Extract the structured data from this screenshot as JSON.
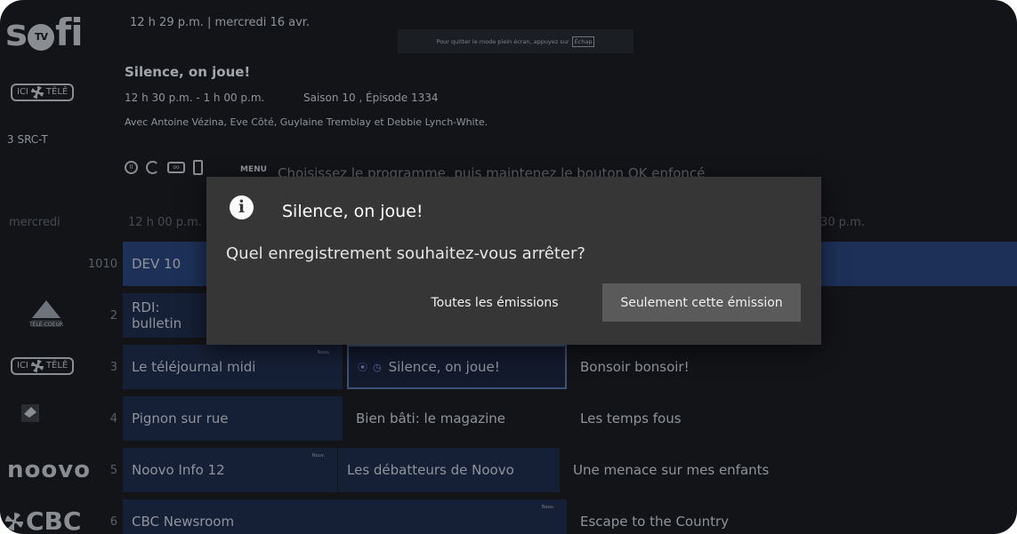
{
  "brand": {
    "logo_left": "s",
    "logo_tv": "TV",
    "logo_right": "fi"
  },
  "header": {
    "time": "12 h 29 p.m.  |  mercredi 16 avr.",
    "fullscreen_notice": "Pour quitter le mode plein écran, appuyez sur",
    "fullscreen_key": "Échap"
  },
  "program": {
    "title": "Silence, on joue!",
    "time_range": "12 h 30 p.m. - 1 h 00 p.m.",
    "season_episode": "Saison 10 , Épisode 1334",
    "cast": "Avec Antoine Vézina, Eve Côté, Guylaine Tremblay et Debbie Lynch-White.",
    "channel_label": "3  SRC-T",
    "channel_logo_left": "ICI",
    "channel_logo_right": "TÊLÊ"
  },
  "controls": {
    "menu_label": "MENU",
    "hint": "Choisissez le programme, puis maintenez le bouton OK enfoncé"
  },
  "timeline": {
    "day": "mercredi",
    "t_start": "12 h 00 p.m.",
    "t_end": "30 p.m."
  },
  "guide": {
    "rows": [
      {
        "number": "1010",
        "logo": "",
        "cells": [
          "DEV 10"
        ]
      },
      {
        "number": "2",
        "logo": "TÉLÉ-COEUR",
        "cells": [
          "RDI: bulletin"
        ]
      },
      {
        "number": "3",
        "logo_left": "ICI",
        "logo_right": "TÊLÊ",
        "cells": [
          "Le téléjournal midi",
          "Silence, on joue!",
          "Bonsoir bonsoir!"
        ],
        "badge": "Nouv."
      },
      {
        "number": "4",
        "logo": "Télé-Québec",
        "cells": [
          "Pignon sur rue",
          "Bien bâti: le magazine",
          "Les temps fous"
        ]
      },
      {
        "number": "5",
        "logo": "noovo",
        "cells": [
          "Noovo Info 12",
          "Les débatteurs de Noovo",
          "Une menace sur mes enfants"
        ],
        "badge": "Nouv."
      },
      {
        "number": "6",
        "logo": "CBC",
        "cells": [
          "CBC Newsroom",
          "Escape to the Country"
        ],
        "badge": "Nouv."
      }
    ]
  },
  "modal": {
    "title": "Silence, on joue!",
    "question": "Quel enregistrement souhaitez-vous arrêter?",
    "btn_all": "Toutes les émissions",
    "btn_this": "Seulement cette émission"
  },
  "colors": {
    "background": "#121418",
    "modal": "#363636",
    "active_row": "#1d3158",
    "primary_button": "#5a5a5a"
  }
}
